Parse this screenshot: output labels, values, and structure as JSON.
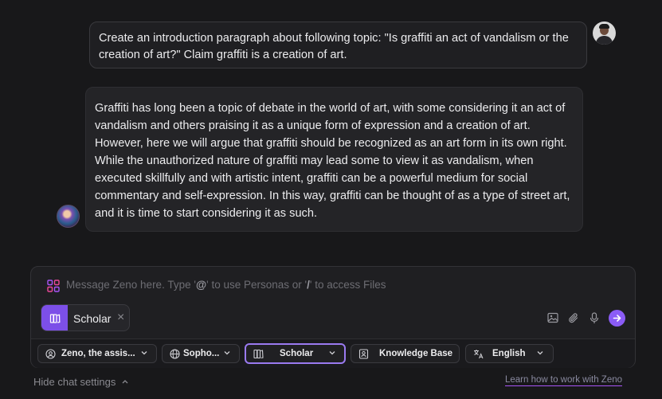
{
  "conversation": {
    "user_message": "Create an introduction paragraph about following topic: \"Is graffiti an act of vandalism or the creation of art?\" Claim graffiti is a creation of art.",
    "assistant_message": "Graffiti has long been a topic of debate in the world of art, with some considering it an act of vandalism and others praising it as a unique form of expression and a creation of art. However, here we will argue that graffiti should be recognized as an art form in its own right. While the unauthorized nature of graffiti may lead some to view it as vandalism, when executed skillfully and with artistic intent, graffiti can be a powerful medium for social commentary and self-expression. In this way, graffiti can be thought of as a type of street art, and it is time to start considering it as such."
  },
  "composer": {
    "placeholder_prefix": "Message Zeno here. Type '",
    "placeholder_at": "@",
    "placeholder_middle": "' to use Personas or '",
    "placeholder_slash": "/",
    "placeholder_suffix": "' to access Files",
    "active_chip": {
      "label": "Scholar",
      "close": "×"
    }
  },
  "settings": {
    "persona": "Zeno, the assis...",
    "model": "Sopho...",
    "mode": "Scholar",
    "knowledge": "Knowledge Base",
    "language": "English"
  },
  "footer": {
    "hide_settings": "Hide chat settings",
    "learn_link": "Learn how to work with Zeno"
  },
  "icons": {
    "composer_grid": "grid-icon",
    "chip": "book-icon",
    "image": "image-icon",
    "attach": "paperclip-icon",
    "mic": "microphone-icon",
    "send": "arrow-right-icon",
    "persona": "persona-icon",
    "model": "globe-icon",
    "mode": "book-icon",
    "knowledge": "knowledge-base-icon",
    "language": "translate-icon"
  },
  "colors": {
    "accent": "#8b5cf6",
    "background": "#18181a",
    "bubble_user": "#1f1f22",
    "bubble_bot": "#242427"
  }
}
